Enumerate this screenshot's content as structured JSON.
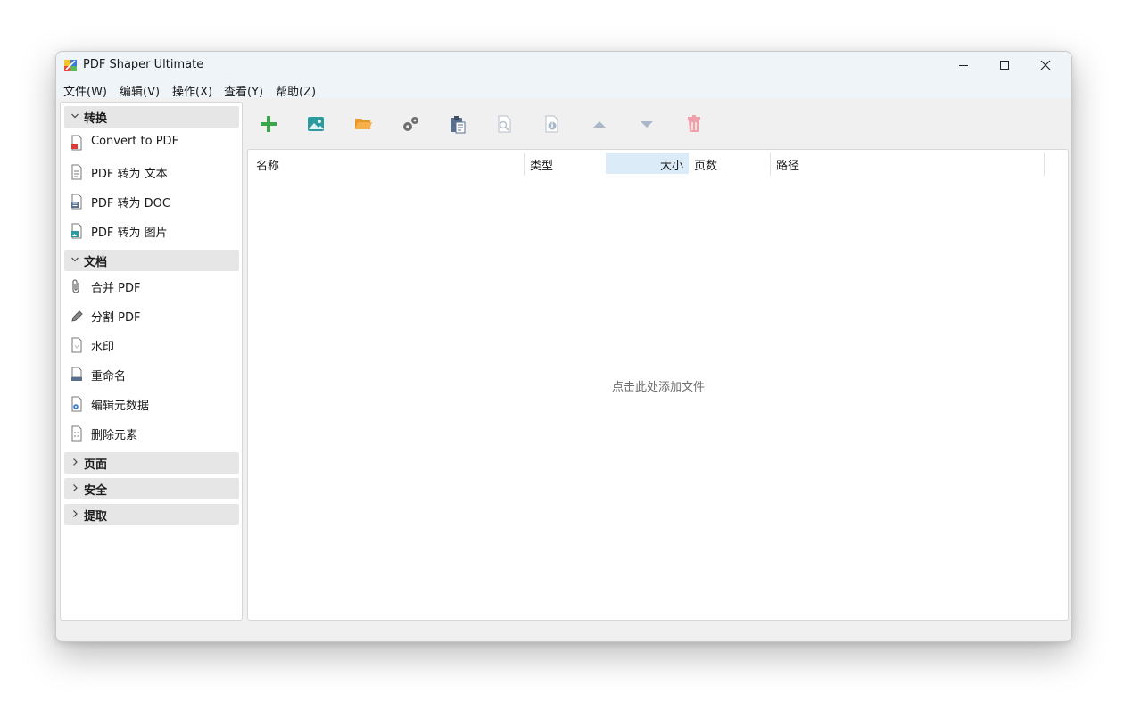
{
  "window": {
    "title": "PDF Shaper Ultimate",
    "controls": {
      "minimize": "minimize",
      "maximize": "maximize",
      "close": "close"
    }
  },
  "menubar": {
    "items": [
      {
        "label": "文件(W)"
      },
      {
        "label": "编辑(V)"
      },
      {
        "label": "操作(X)"
      },
      {
        "label": "查看(Y)"
      },
      {
        "label": "帮助(Z)"
      }
    ]
  },
  "sidebar": {
    "groups": [
      {
        "label": "转换",
        "expanded": true,
        "items": [
          {
            "label": "Convert to PDF",
            "icon": "pdf-file-icon"
          },
          {
            "label": "PDF 转为 文本",
            "icon": "text-file-icon"
          },
          {
            "label": "PDF 转为 DOC",
            "icon": "doc-file-icon"
          },
          {
            "label": "PDF 转为 图片",
            "icon": "image-file-icon"
          }
        ]
      },
      {
        "label": "文档",
        "expanded": true,
        "items": [
          {
            "label": "合并 PDF",
            "icon": "paperclip-icon"
          },
          {
            "label": "分割 PDF",
            "icon": "pencil-icon"
          },
          {
            "label": "水印",
            "icon": "watermark-file-icon"
          },
          {
            "label": "重命名",
            "icon": "rename-file-icon"
          },
          {
            "label": "编辑元数据",
            "icon": "metadata-gear-icon"
          },
          {
            "label": "删除元素",
            "icon": "remove-elements-icon"
          }
        ]
      },
      {
        "label": "页面",
        "expanded": false,
        "items": []
      },
      {
        "label": "安全",
        "expanded": false,
        "items": []
      },
      {
        "label": "提取",
        "expanded": false,
        "items": []
      }
    ]
  },
  "toolbar": {
    "buttons": [
      {
        "icon": "add-icon",
        "enabled": true
      },
      {
        "icon": "add-image-icon",
        "enabled": true
      },
      {
        "icon": "open-folder-icon",
        "enabled": true
      },
      {
        "icon": "settings-gears-icon",
        "enabled": true
      },
      {
        "icon": "clipboard-icon",
        "enabled": true
      },
      {
        "icon": "preview-icon",
        "enabled": false
      },
      {
        "icon": "info-icon",
        "enabled": false
      },
      {
        "icon": "move-up-icon",
        "enabled": false
      },
      {
        "icon": "move-down-icon",
        "enabled": false
      },
      {
        "icon": "delete-icon",
        "enabled": false
      }
    ]
  },
  "filelist": {
    "columns": [
      {
        "label": "名称"
      },
      {
        "label": "类型"
      },
      {
        "label": "大小",
        "sorted": true
      },
      {
        "label": "页数"
      },
      {
        "label": "路径"
      }
    ],
    "empty_text": "点击此处添加文件"
  },
  "colors": {
    "accent_green": "#3aa54a",
    "folder_orange": "#f0a43a",
    "image_teal": "#2e9aa0",
    "gear_gray": "#6f6f6f",
    "disabled_blue": "#aab7c8",
    "disabled_red": "#f0a0a8",
    "sorted_header_bg": "#dcebf8"
  }
}
